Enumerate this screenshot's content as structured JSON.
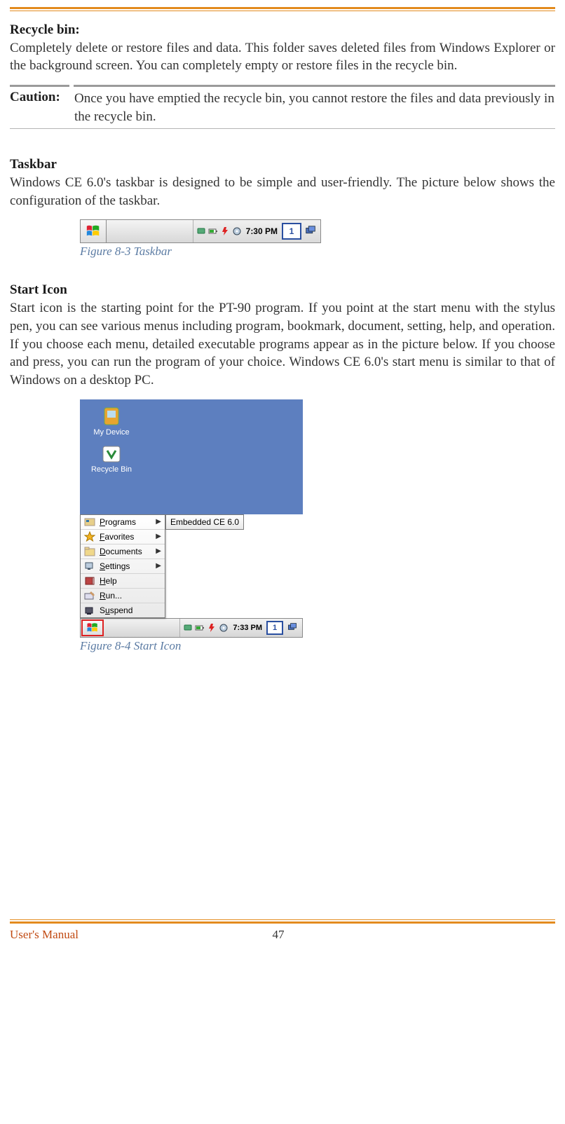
{
  "rules": {},
  "section1": {
    "title": "Recycle bin:",
    "body": "Completely delete or restore files and data. This folder saves deleted files from Windows Explorer or the background screen. You can completely empty or restore files in the recycle bin."
  },
  "caution": {
    "label": "Caution:",
    "text": "Once you have emptied the recycle bin, you cannot restore the files and data previously in the recycle bin."
  },
  "section2": {
    "title": "Taskbar",
    "body": "Windows CE 6.0's taskbar is designed to be simple and user-friendly. The picture below shows the configuration of the taskbar."
  },
  "fig83": {
    "caption": "Figure 8-3 Taskbar",
    "time": "7:30 PM",
    "kbd": "1"
  },
  "section3": {
    "title": "Start Icon",
    "body": "Start icon is the starting point for the PT-90 program. If you point at the start menu with the stylus pen, you can see various menus including program, bookmark, document, setting, help, and operation. If you choose each menu, detailed executable programs appear as in the picture below. If you choose and press, you can run the program of your choice. Windows CE 6.0's start menu is similar to that of Windows on a desktop PC."
  },
  "fig84": {
    "caption": "Figure 8-4 Start Icon",
    "desktop_icons": [
      {
        "label": "My Device"
      },
      {
        "label": "Recycle Bin"
      }
    ],
    "menu": [
      {
        "label": "Programs",
        "u": "P",
        "rest": "rograms",
        "arrow": true,
        "icon": "programs"
      },
      {
        "label": "Favorites",
        "u": "F",
        "rest": "avorites",
        "arrow": true,
        "icon": "favorites"
      },
      {
        "label": "Documents",
        "u": "D",
        "rest": "ocuments",
        "arrow": true,
        "icon": "documents"
      },
      {
        "label": "Settings",
        "u": "S",
        "rest": "ettings",
        "arrow": true,
        "icon": "settings"
      },
      {
        "label": "Help",
        "u": "H",
        "rest": "elp",
        "arrow": false,
        "icon": "help"
      },
      {
        "label": "Run...",
        "u": "R",
        "rest": "un...",
        "arrow": false,
        "icon": "run"
      },
      {
        "label": "Suspend",
        "u": "u",
        "pre": "S",
        "rest2": "spend",
        "arrow": false,
        "icon": "suspend"
      }
    ],
    "submenu": "Embedded CE 6.0",
    "time": "7:33 PM",
    "kbd": "1"
  },
  "footer": {
    "left": "User's Manual",
    "page": "47"
  }
}
